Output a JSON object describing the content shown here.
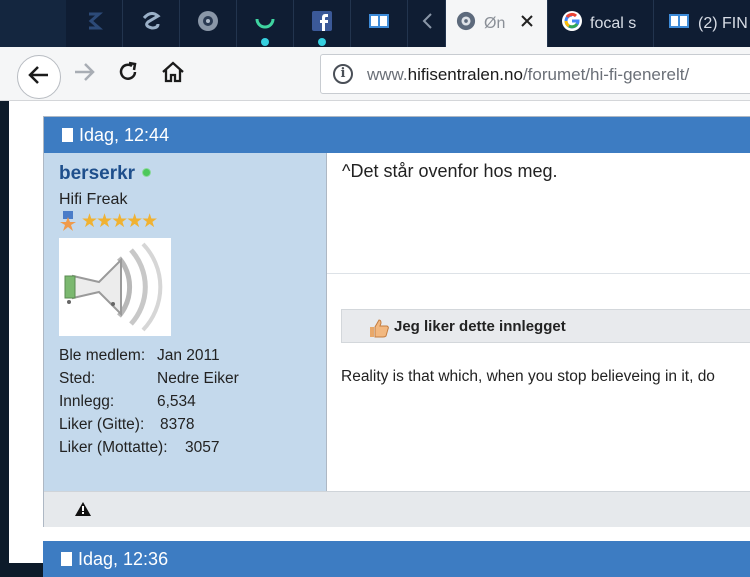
{
  "browser": {
    "tabs": [
      {
        "icon": "s-logo-icon"
      },
      {
        "icon": "s-swirl-icon"
      },
      {
        "icon": "disc-icon"
      },
      {
        "icon": "loading-arc-icon"
      },
      {
        "icon": "facebook-icon"
      },
      {
        "icon": "book-icon"
      },
      {
        "icon": "chevron-left-icon"
      },
      {
        "title": "Øn",
        "icon": "disc-icon"
      },
      {
        "title": "focal s",
        "icon": "google-icon"
      },
      {
        "title": "(2) FIN",
        "icon": "book-icon"
      }
    ],
    "url_prefix": "www.",
    "url_domain": "hifisentralen.no",
    "url_path": "/forumet/hi-fi-generelt/"
  },
  "post1": {
    "time": "Idag, 12:44",
    "username": "berserkr",
    "rank": "Hifi Freak",
    "stars": "★★★★★",
    "stats": [
      {
        "label": "Ble medlem:",
        "value": "Jan 2011"
      },
      {
        "label": "Sted:",
        "value": "Nedre Eiker"
      },
      {
        "label": "Innlegg:",
        "value": "6,534"
      },
      {
        "label": "Liker (Gitte):",
        "value": "8378"
      },
      {
        "label": "Liker (Mottatte):",
        "value": "3057"
      }
    ],
    "message": "^Det står ovenfor hos meg.",
    "like_label": "Jeg liker dette innlegget",
    "signature": "Reality is that which, when you stop believeing in it, do"
  },
  "post2": {
    "time": "Idag, 12:36"
  }
}
